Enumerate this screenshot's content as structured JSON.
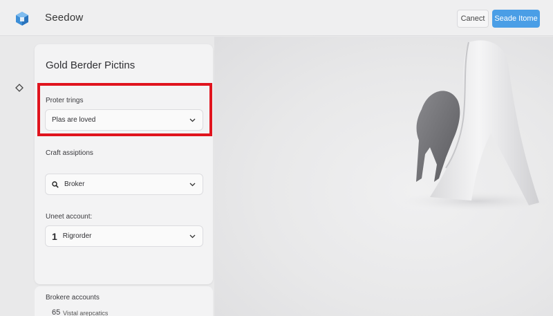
{
  "header": {
    "app_title": "Seedow",
    "cancel_label": "Canect",
    "primary_label": "Seade Itome",
    "logo_icon": "cube-logo-icon",
    "accent_color": "#4a9ee6"
  },
  "rail": {
    "icon": "diamond-icon"
  },
  "card": {
    "title": "Gold Berder Pictins",
    "fields": [
      {
        "label": "Proter trings",
        "value": "Plas are loved",
        "trailing_icon": "chevron-down-icon"
      },
      {
        "label": "Craft assiptions",
        "value": "Broker",
        "lead_icon": "search-icon",
        "trailing_icon": "chevron-down-icon"
      },
      {
        "label": "Uneet account:",
        "lead_number": "1",
        "value": "Rigrorder",
        "trailing_icon": "chevron-down-icon"
      }
    ]
  },
  "highlight": {
    "color": "#e0141e"
  },
  "lower_card": {
    "title": "Brokere accounts",
    "item_number": "65",
    "item_text": "Vistal arepcatics"
  }
}
